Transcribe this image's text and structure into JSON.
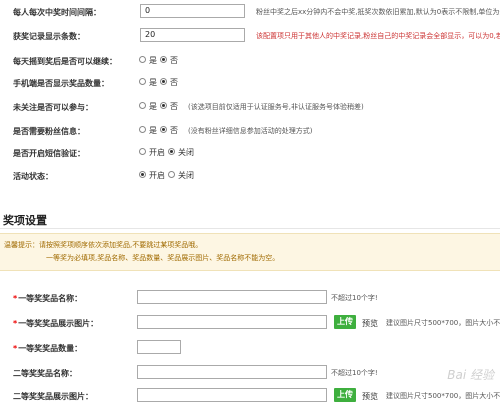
{
  "settings": {
    "interval": {
      "label": "每人每次中奖时间间隔：",
      "value": "0",
      "hint": "粉丝中奖之后xx分钟内不会中奖,抵奖次数依旧累加,默认为0表示不限制,单位为分钟"
    },
    "records": {
      "label": "获奖记录显示条数：",
      "value": "20",
      "hint": "该配置项只用于其他人的中奖记录,粉丝自己的中奖记录会全部显示，可以为0,若为0前"
    },
    "continue": {
      "label": "每天摇到奖后是否可以继续：",
      "opt1": "是",
      "opt2": "否"
    },
    "mobile": {
      "label": "手机端是否显示奖品数量：",
      "opt1": "是",
      "opt2": "否"
    },
    "unfollow": {
      "label": "未关注是否可以参与：",
      "opt1": "是",
      "opt2": "否",
      "note": "(该选项目前仅适用于认证服务号,非认证服务号体验稍差)"
    },
    "fans_info": {
      "label": "是否需要粉丝信息：",
      "opt1": "是",
      "opt2": "否",
      "note": "(没有粉丝详细信息参加活动的处理方式)"
    },
    "sms": {
      "label": "是否开启短信验证：",
      "opt1": "开启",
      "opt2": "关闭"
    },
    "status": {
      "label": "活动状态：",
      "opt1": "开启",
      "opt2": "关闭"
    }
  },
  "prize_section": {
    "title": "奖项设置",
    "notice_line1": "温馨提示：请按照奖项顺序依次添加奖品,不要跳过某项奖品哦。",
    "notice_line2": "一等奖为必填项,奖品名称、奖品数量、奖品展示图片、奖品名称不能为空。",
    "first_name": {
      "label": "一等奖奖品名称：",
      "hint": "不超过10个字!"
    },
    "first_image": {
      "label": "一等奖奖品展示图片：",
      "upload": "上传",
      "preview": "预览",
      "hint": "建议图片尺寸500*700，图片大小不"
    },
    "first_count": {
      "label": "一等奖奖品数量："
    },
    "second_name": {
      "label": "二等奖奖品名称：",
      "hint": "不超过10个字!"
    },
    "second_image": {
      "label": "二等奖奖品展示图片：",
      "upload": "上传",
      "preview": "预览",
      "hint": "建议图片尺寸500*700，图片大小不"
    }
  },
  "watermark": "Bai 经验"
}
